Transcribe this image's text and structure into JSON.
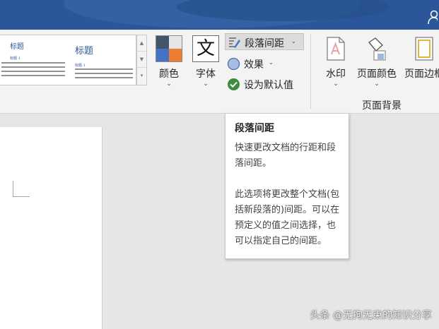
{
  "ribbon": {
    "styles_gallery": {
      "style1_title": "标题",
      "style1_sub": "标题 1",
      "style2_title": "标题",
      "style2_sub": "标题 1"
    },
    "colors_label": "颜色",
    "fonts_label": "字体",
    "fonts_glyph": "文",
    "paragraph_spacing_label": "段落间距",
    "effects_label": "效果",
    "set_default_label": "设为默认值",
    "watermark_label": "水印",
    "page_color_label": "页面颜色",
    "page_borders_label": "页面边框",
    "page_background_group_label": "页面背景",
    "theme_colors": [
      "#44546a",
      "#4472c4",
      "#e7e6e6",
      "#ed7d31"
    ]
  },
  "tooltip": {
    "title": "段落间距",
    "body": "快速更改文档的行距和段落间距。\n\n此选项将更改整个文档(包括新段落的)间距。可以在预定义的值之间选择，也可以指定自己的间距。"
  },
  "credit": "头条 @无拘无束的知识分享",
  "icons": {
    "chevron": "⌄",
    "effects": "circle-icon",
    "set_default": "checkmark-icon"
  }
}
